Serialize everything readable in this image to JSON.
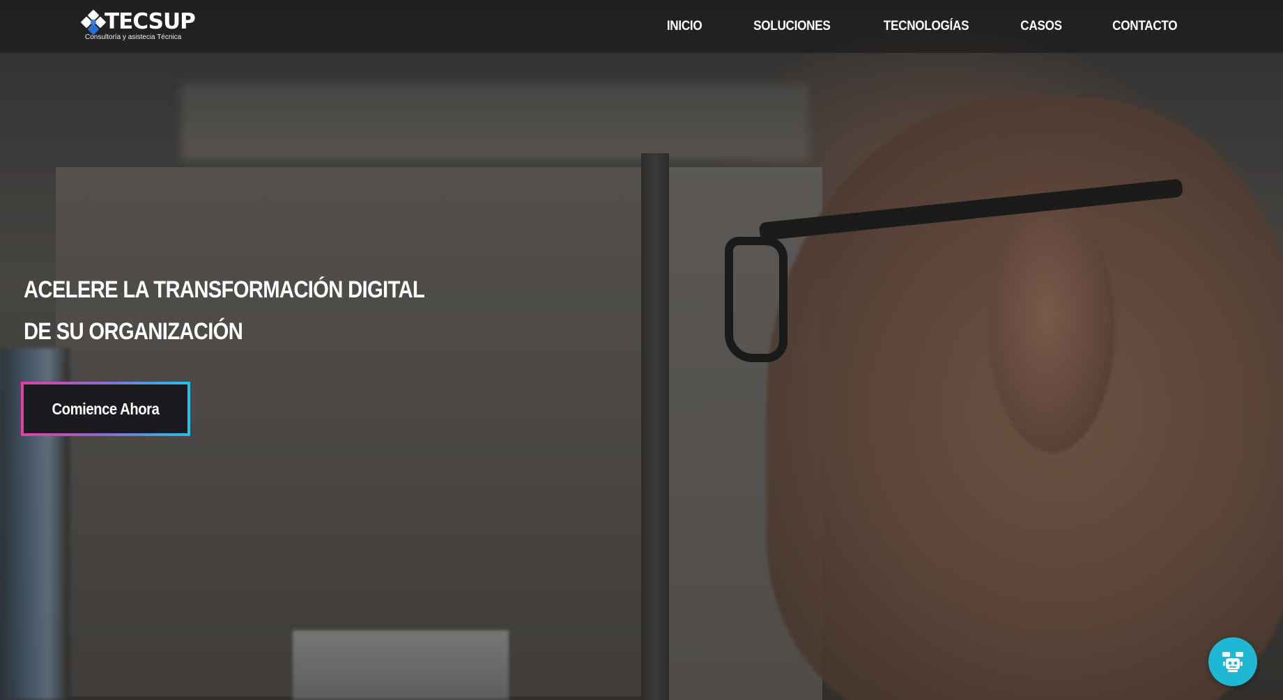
{
  "brand": {
    "name": "TECSUP",
    "tagline": "Consultoría y asistecia Técnica",
    "logo_icon": "diamond-grid-logo-icon"
  },
  "nav": {
    "items": [
      {
        "label": "INICIO"
      },
      {
        "label": "SOLUCIONES"
      },
      {
        "label": "TECNOLOGÍAS"
      },
      {
        "label": "CASOS"
      },
      {
        "label": "CONTACTO"
      }
    ]
  },
  "hero": {
    "headline_line1": "ACELERE LA TRANSFORMACIÓN DIGITAL",
    "headline_line2": "DE SU ORGANIZACIÓN",
    "cta_label": "Comience Ahora",
    "background": "photo of man with glasses at office desk"
  },
  "chatbot": {
    "icon": "robot-icon"
  },
  "colors": {
    "header_bg": "#141414",
    "cta_bg": "#1b1b1f",
    "cta_border_start": "#e040a0",
    "cta_border_end": "#1fc3e8",
    "chatbot_bg": "#1fb8d4",
    "text": "#ffffff"
  }
}
